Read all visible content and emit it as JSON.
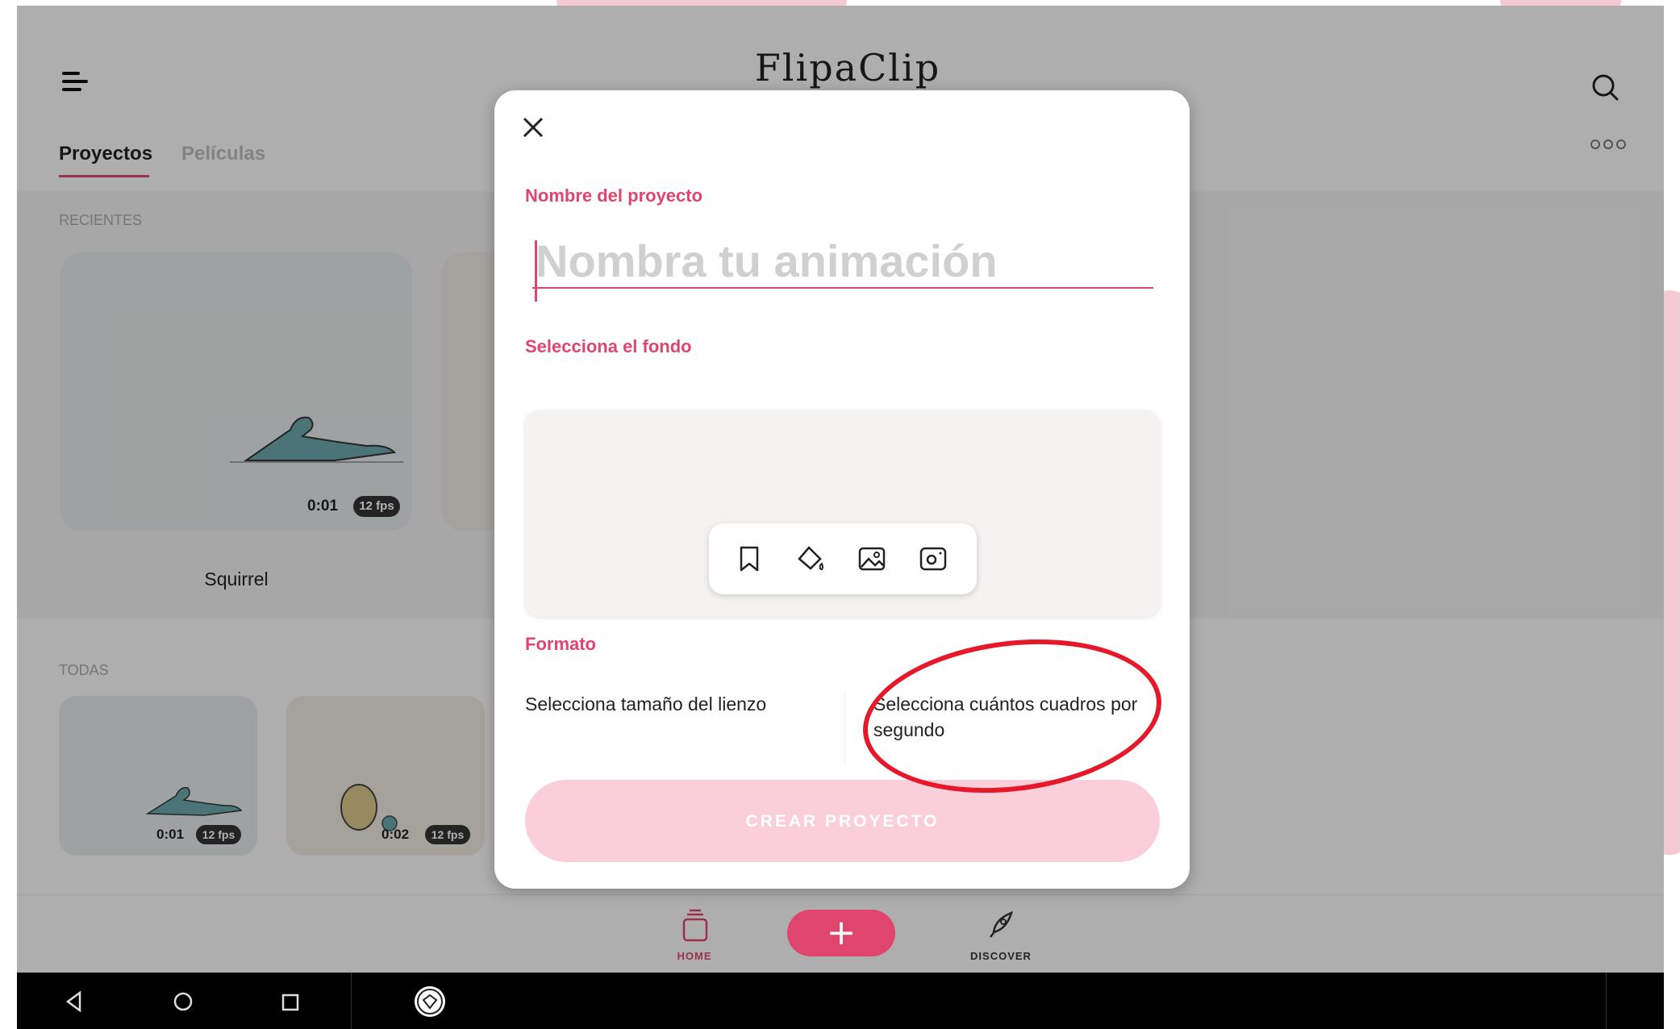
{
  "app": {
    "logo_text": "FlipaClip",
    "tabs": [
      {
        "label": "Proyectos"
      },
      {
        "label": "Películas"
      }
    ]
  },
  "recents": {
    "label": "RECIENTES",
    "cards": [
      {
        "time": "0:01",
        "fps": "12 fps",
        "title": "Squirrel"
      }
    ]
  },
  "all": {
    "label": "TODAS",
    "cards": [
      {
        "time": "0:01",
        "fps": "12 fps"
      },
      {
        "time": "0:02",
        "fps": "12 fps"
      }
    ]
  },
  "bottom_nav": {
    "home_label": "HOME",
    "add_label": "+",
    "discover_label": "DISCOVER"
  },
  "dialog": {
    "name_label": "Nombre del proyecto",
    "name_placeholder": "Nombra tu animación",
    "name_value": "",
    "background_label": "Selecciona el fondo",
    "background_tools": [
      "bookmark-icon",
      "paint-bucket-icon",
      "image-icon",
      "camera-icon"
    ],
    "format_label": "Formato",
    "canvas_size_text": "Selecciona tamaño del lienzo",
    "fps_text": "Selecciona cuántos cuadros por segundo",
    "create_button": "CREAR PROYECTO"
  },
  "colors": {
    "accent": "#e0466d",
    "create_disabled": "#fbcfd9",
    "annotation": "#e6192b"
  }
}
